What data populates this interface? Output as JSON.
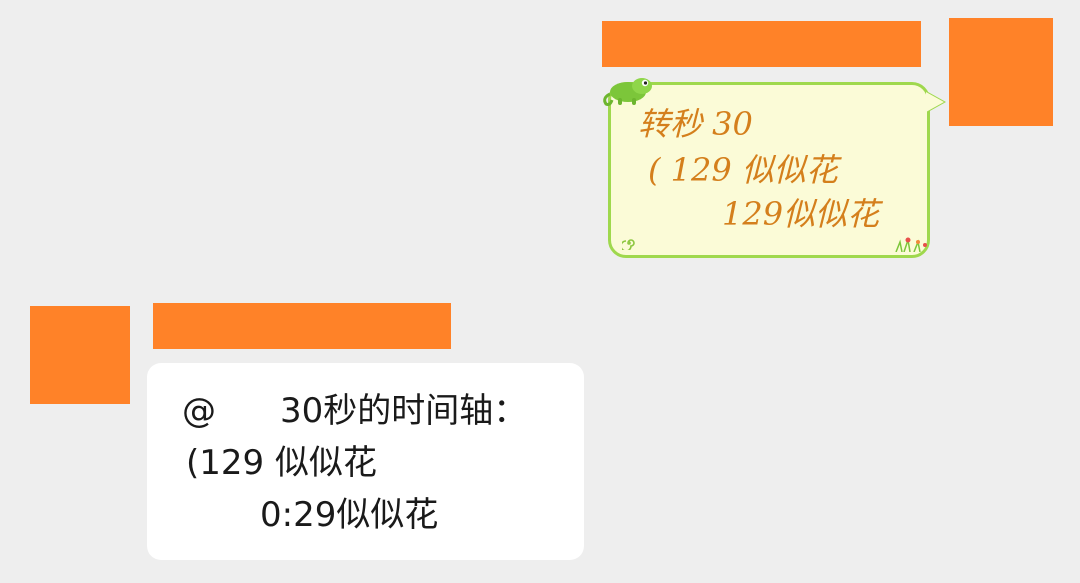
{
  "colors": {
    "background": "#eeeeee",
    "redaction": "#ff8228",
    "themed_bubble_fill": "#fbfbd7",
    "themed_bubble_border": "#9fd84d",
    "themed_text": "#d47f1c",
    "white_bubble": "#ffffff",
    "text": "#1a1a1a"
  },
  "outgoing_message": {
    "lines": [
      "转秒 30",
      "( 129 似似花",
      "129似似花"
    ],
    "icons": [
      "chameleon-icon",
      "swirl-icon",
      "flowers-icon"
    ]
  },
  "incoming_message": {
    "mention": "@",
    "lines": [
      "30秒的时间轴：",
      "(129 似似花",
      "0:29似似花"
    ]
  }
}
